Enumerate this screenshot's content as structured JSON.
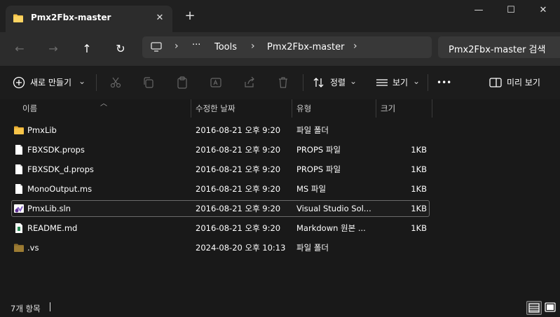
{
  "window": {
    "tab_title": "Pmx2Fbx-master",
    "close_tab": "✕",
    "new_tab": "+",
    "minimize": "—",
    "maximize": "☐",
    "close": "✕"
  },
  "nav": {
    "back": "←",
    "forward": "→",
    "up": "↑",
    "refresh": "↻"
  },
  "address": {
    "more": "···",
    "crumbs": [
      "Tools",
      "Pmx2Fbx-master"
    ],
    "separator": "›"
  },
  "search": {
    "placeholder": "Pmx2Fbx-master 검색"
  },
  "toolbar": {
    "new_label": "새로 만들기",
    "sort_label": "정렬",
    "view_label": "보기",
    "more": "•••",
    "preview_label": "미리 보기",
    "chevron": "⌄"
  },
  "columns": {
    "name": "이름",
    "modified": "수정한 날짜",
    "type": "유형",
    "size": "크기"
  },
  "files": [
    {
      "name": "PmxLib",
      "modified": "2016-08-21 오후 9:20",
      "type": "파일 폴더",
      "size": "",
      "icon": "folder-icon"
    },
    {
      "name": "FBXSDK.props",
      "modified": "2016-08-21 오후 9:20",
      "type": "PROPS 파일",
      "size": "1KB",
      "icon": "file-icon"
    },
    {
      "name": "FBXSDK_d.props",
      "modified": "2016-08-21 오후 9:20",
      "type": "PROPS 파일",
      "size": "1KB",
      "icon": "file-icon"
    },
    {
      "name": "MonoOutput.ms",
      "modified": "2016-08-21 오후 9:20",
      "type": "MS 파일",
      "size": "1KB",
      "icon": "file-icon"
    },
    {
      "name": "PmxLib.sln",
      "modified": "2016-08-21 오후 9:20",
      "type": "Visual Studio Sol...",
      "size": "1KB",
      "icon": "visual-studio-solution-icon"
    },
    {
      "name": "README.md",
      "modified": "2016-08-21 오후 9:20",
      "type": "Markdown 원본 ...",
      "size": "1KB",
      "icon": "markdown-file-icon"
    },
    {
      "name": ".vs",
      "modified": "2024-08-20 오후 10:13",
      "type": "파일 폴더",
      "size": "",
      "icon": "hidden-folder-icon"
    }
  ],
  "status": {
    "item_count": "7개 항목"
  },
  "colors": {
    "background": "#191919",
    "toolbar": "#1c1c1c",
    "address_bar": "#2c2c2c",
    "folder": "#f7c449",
    "selection_border": "#6b6b6b"
  }
}
